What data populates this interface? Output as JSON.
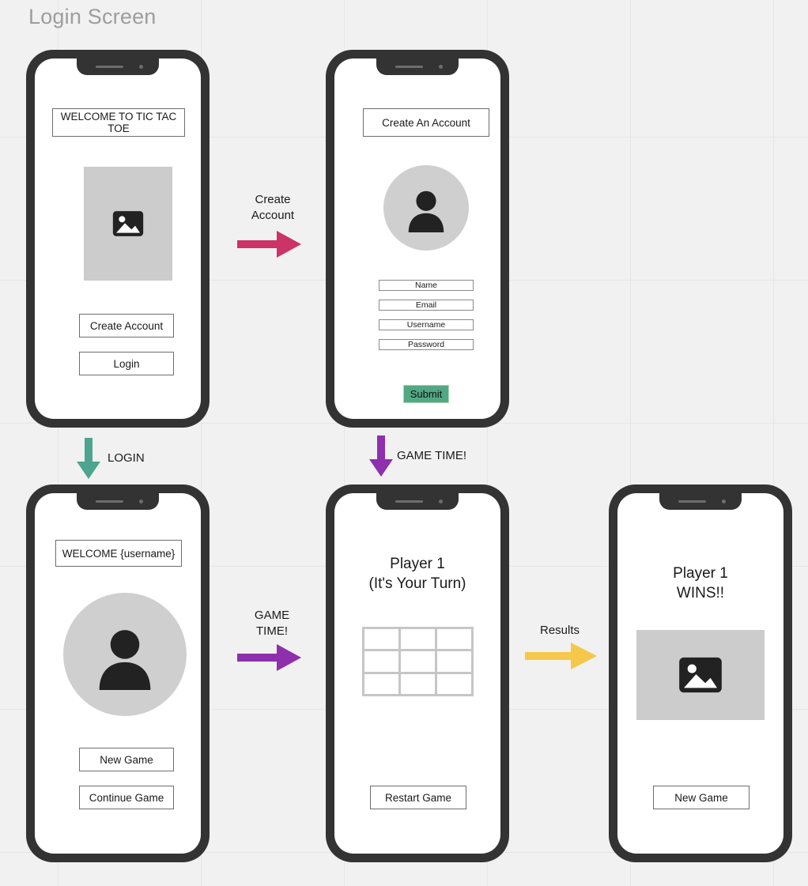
{
  "page": {
    "title": "Login Screen",
    "background_color": "#f1f1f1",
    "grid_line_color": "#e6e6e6"
  },
  "colors": {
    "phone_frame": "#333333",
    "arrow_pink": "#cc3366",
    "arrow_teal": "#4da58f",
    "arrow_purple": "#8e2fae",
    "arrow_yellow": "#f5c84c",
    "submit_green": "#52a884",
    "placeholder_gray": "#cccccc",
    "avatar_gray": "#cfcfcf"
  },
  "screens": {
    "welcome": {
      "name": "Welcome / Login screen",
      "title": "WELCOME TO TIC TAC TOE",
      "image_placeholder_icon": "image-placeholder-icon",
      "buttons": [
        {
          "label": "Create Account"
        },
        {
          "label": "Login"
        }
      ]
    },
    "create_account": {
      "name": "Create account screen",
      "title": "Create An Account",
      "avatar_icon": "person-avatar-icon",
      "fields": [
        {
          "label": "Name"
        },
        {
          "label": "Email"
        },
        {
          "label": "Username"
        },
        {
          "label": "Password"
        }
      ],
      "submit_label": "Submit"
    },
    "user_home": {
      "name": "Logged in home screen",
      "title": "WELCOME  {username}",
      "avatar_icon": "person-avatar-icon",
      "buttons": [
        {
          "label": "New Game"
        },
        {
          "label": "Continue Game"
        }
      ]
    },
    "game_board": {
      "name": "Game board screen",
      "heading_line_1": "Player 1",
      "heading_line_2": "(It's Your Turn)",
      "board": {
        "rows": 3,
        "cols": 3,
        "cells": [
          "",
          "",
          "",
          "",
          "",
          "",
          "",
          "",
          ""
        ]
      },
      "button_label": "Restart Game"
    },
    "results": {
      "name": "Winner results screen",
      "heading_line_1": "Player 1",
      "heading_line_2": "WINS!!",
      "image_placeholder_icon": "image-placeholder-icon",
      "button_label": "New Game"
    }
  },
  "flows": [
    {
      "id": "create-account",
      "label": "Create\nAccount",
      "direction": "right",
      "color": "#cc3366"
    },
    {
      "id": "login",
      "label": "LOGIN",
      "direction": "down",
      "color": "#4da58f"
    },
    {
      "id": "game-time-down",
      "label": "GAME TIME!",
      "direction": "down",
      "color": "#8e2fae"
    },
    {
      "id": "game-time-right",
      "label": "GAME\nTIME!",
      "direction": "right",
      "color": "#8e2fae"
    },
    {
      "id": "results",
      "label": "Results",
      "direction": "right",
      "color": "#f5c84c"
    }
  ]
}
